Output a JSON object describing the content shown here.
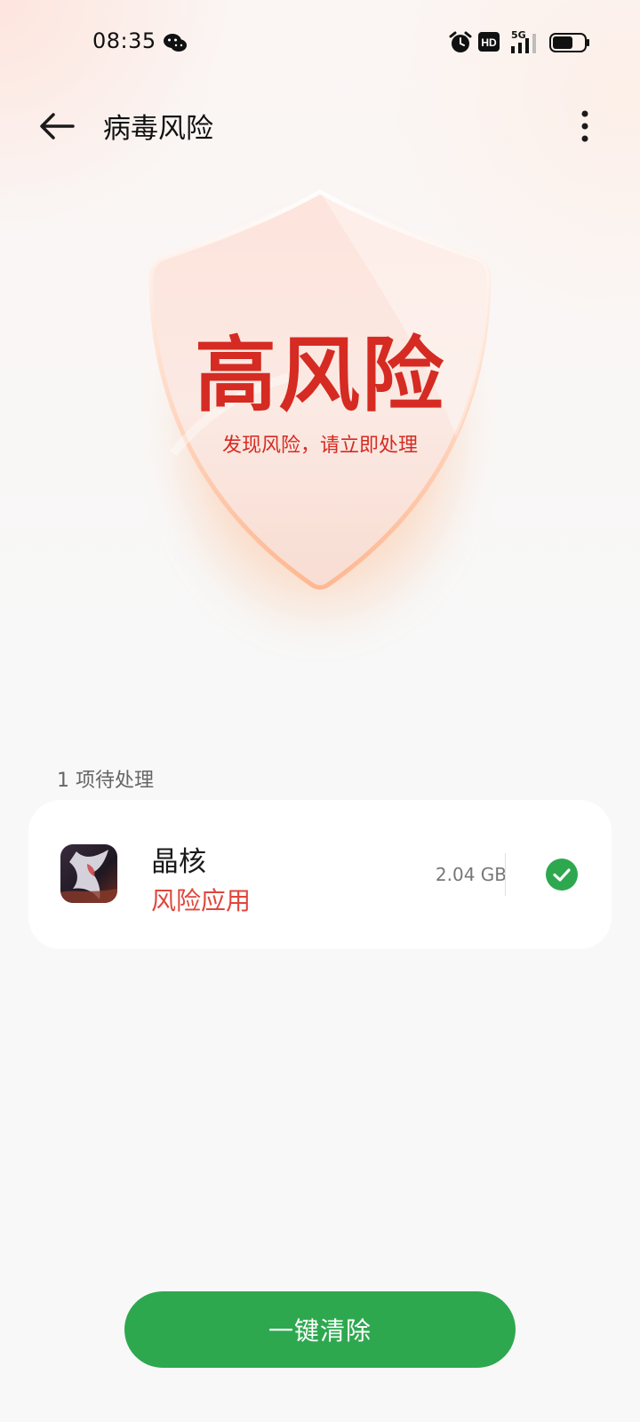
{
  "status_bar": {
    "time": "08:35",
    "network": "5G",
    "icons": [
      "wechat-icon",
      "alarm-icon",
      "hd-icon",
      "signal-icon",
      "battery-icon"
    ]
  },
  "header": {
    "title": "病毒风险",
    "back_icon": "arrow-left-icon",
    "more_icon": "more-vertical-icon"
  },
  "risk": {
    "level": "高风险",
    "description": "发现风险，请立即处理"
  },
  "pending": {
    "label": "1 项待处理",
    "items": [
      {
        "name": "晶核",
        "risk_label": "风险应用",
        "size": "2.04 GB",
        "checked": true
      }
    ]
  },
  "actions": {
    "clean_all": "一键清除"
  },
  "colors": {
    "risk_red": "#d52b22",
    "green": "#2ea84f",
    "text_gray": "#666666"
  }
}
